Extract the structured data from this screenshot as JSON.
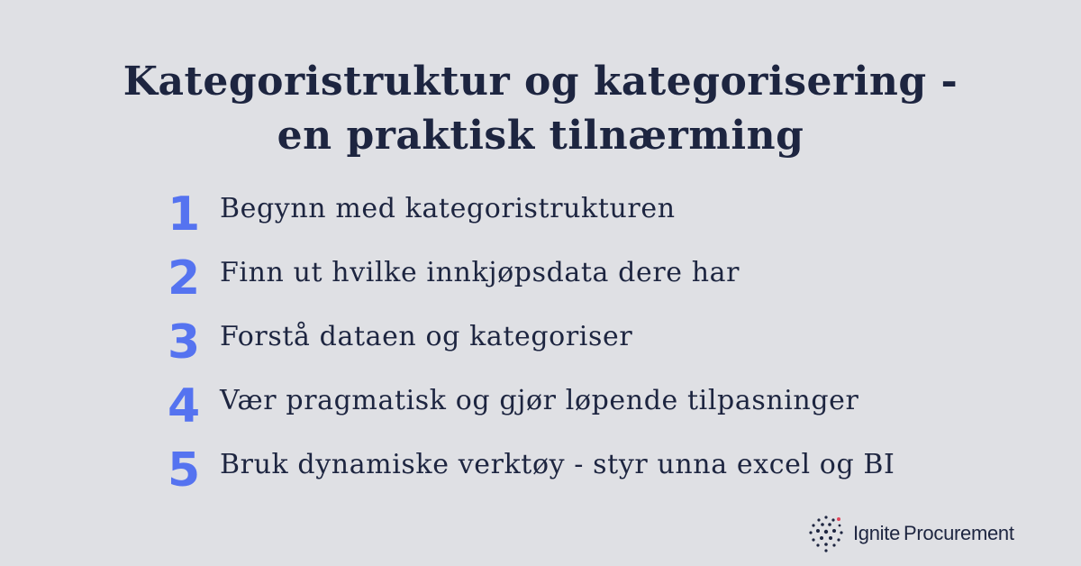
{
  "title": {
    "line1": "Kategoristruktur og kategorisering -",
    "line2": "en praktisk tilnærming"
  },
  "steps": [
    {
      "number": "1",
      "text": "Begynn med kategoristrukturen"
    },
    {
      "number": "2",
      "text": "Finn ut hvilke innkjøpsdata dere har"
    },
    {
      "number": "3",
      "text": "Forstå dataen og kategoriser"
    },
    {
      "number": "4",
      "text": "Vær pragmatisk og gjør løpende tilpasninger"
    },
    {
      "number": "5",
      "text": "Bruk dynamiske verktøy - styr unna excel og BI"
    }
  ],
  "logo": {
    "word1": "Ignite",
    "word2": "Procurement",
    "icon": "dot-sphere-icon"
  },
  "colors": {
    "background": "#dfe0e4",
    "text": "#1d2540",
    "accent": "#5573f0",
    "logo_dot_accent": "#e0455a"
  }
}
